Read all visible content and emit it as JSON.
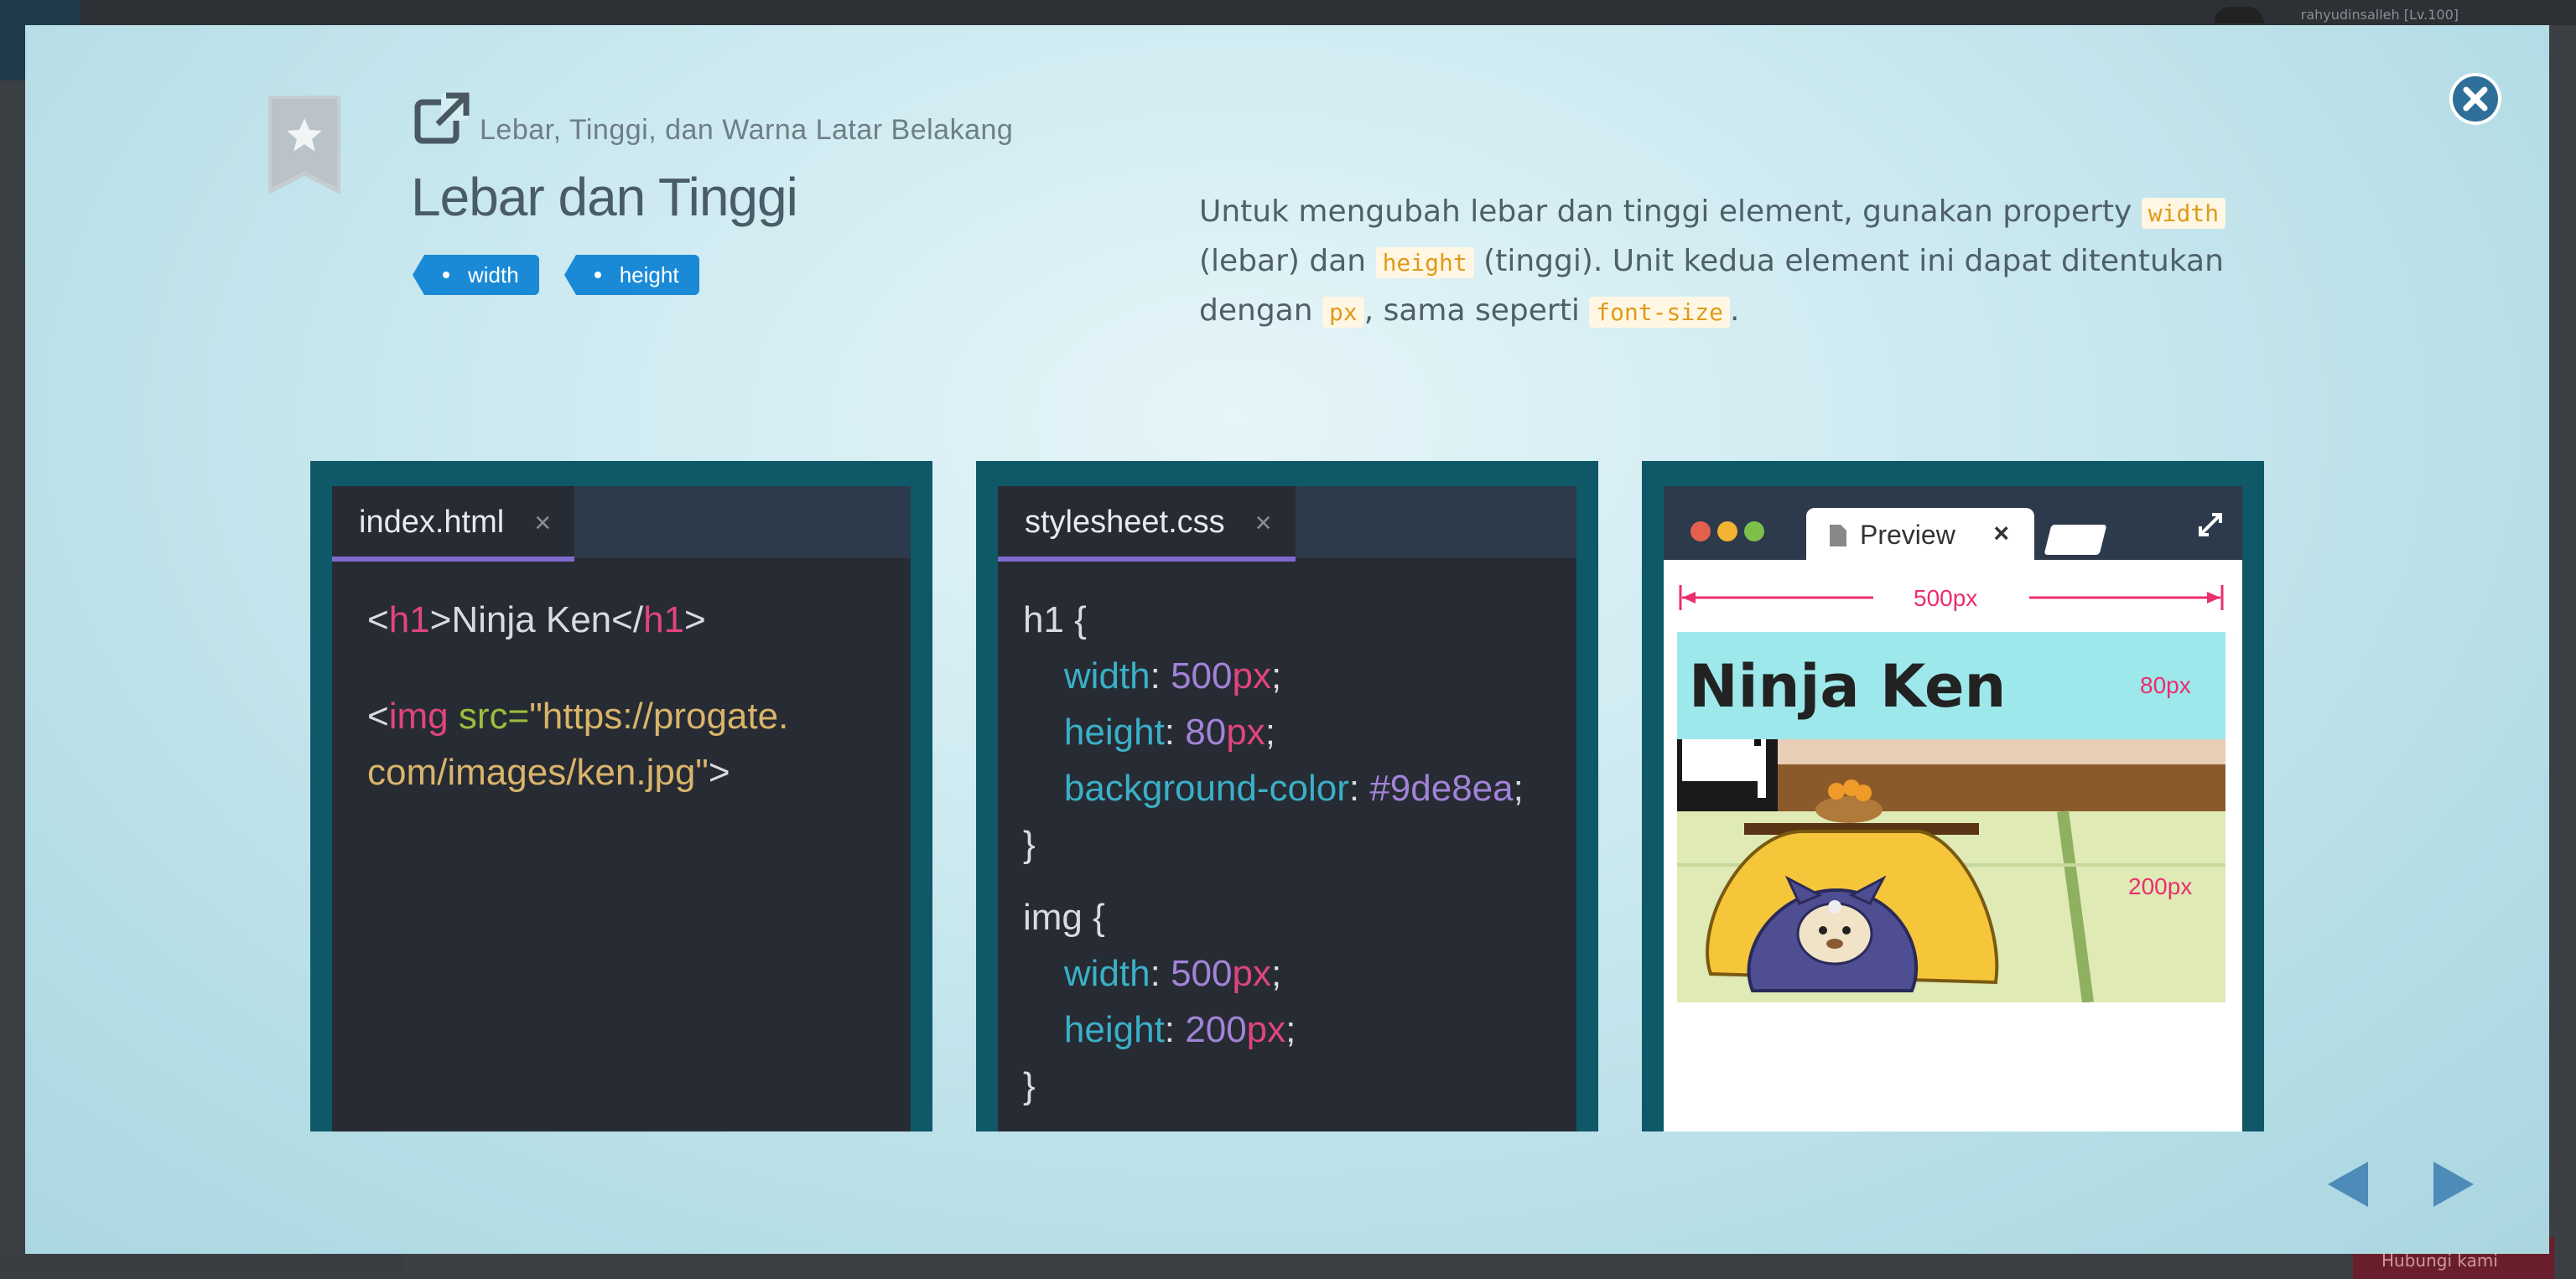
{
  "background": {
    "user_text": "rahyudinsalleh [Lv.100]",
    "bottom_button": "Hubungi kami"
  },
  "modal": {
    "breadcrumb": "Lebar, Tinggi, dan Warna Latar Belakang",
    "title": "Lebar dan Tinggi",
    "tags": [
      "width",
      "height"
    ],
    "description": {
      "p1": "Untuk mengubah lebar dan tinggi element, gunakan property ",
      "code1": "width",
      "p2": " (lebar) dan ",
      "code2": "height",
      "p3": " (tinggi). Unit kedua element ini dapat ditentukan dengan ",
      "code3": "px",
      "p4": ", sama seperti ",
      "code4": "font-size",
      "p5": "."
    }
  },
  "html_editor": {
    "tab_label": "index.html",
    "tab_close": "×",
    "line1": {
      "lt": "<",
      "tag": "h1",
      "gt": ">",
      "text": "Ninja Ken",
      "close_lt": "</",
      "close_tag": "h1",
      "close_gt": ">"
    },
    "line2": {
      "lt": "<",
      "tag": "img",
      "attr": " src=",
      "str1": "\"https://progate.",
      "str2": "com/images/ken.jpg\"",
      "gt": ">"
    }
  },
  "css_editor": {
    "tab_label": "stylesheet.css",
    "tab_close": "×",
    "rule1_selector": "h1 {",
    "rule1": [
      {
        "prop": "width",
        "num": "500",
        "unit": "px"
      },
      {
        "prop": "height",
        "num": "80",
        "unit": "px"
      },
      {
        "prop": "background-color",
        "hex": "#9de8ea"
      }
    ],
    "rule1_close": "}",
    "rule2_selector": "img {",
    "rule2": [
      {
        "prop": "width",
        "num": "500",
        "unit": "px"
      },
      {
        "prop": "height",
        "num": "200",
        "unit": "px"
      }
    ],
    "rule2_close": "}"
  },
  "preview": {
    "tab_label": "Preview",
    "tab_close": "×",
    "h1_text": "Ninja Ken",
    "width_label": "500px",
    "h1_height_label": "80px",
    "img_height_label": "200px"
  },
  "colors": {
    "accent_blue": "#1a8ad6",
    "panel_teal": "#0f5868",
    "editor_bg": "#272b33",
    "css_tag": "#e0457b",
    "css_prop": "#3ab0c8",
    "css_value": "#a283d8",
    "h1_bg": "#9de8ea",
    "dimension_pink": "#ea2e6e"
  },
  "icons": {
    "bookmark": "bookmark-star-icon",
    "external": "external-link-icon",
    "close": "close-circle-icon",
    "prev": "arrow-left-icon",
    "next": "arrow-right-icon",
    "expand": "expand-icon",
    "file": "file-icon"
  }
}
